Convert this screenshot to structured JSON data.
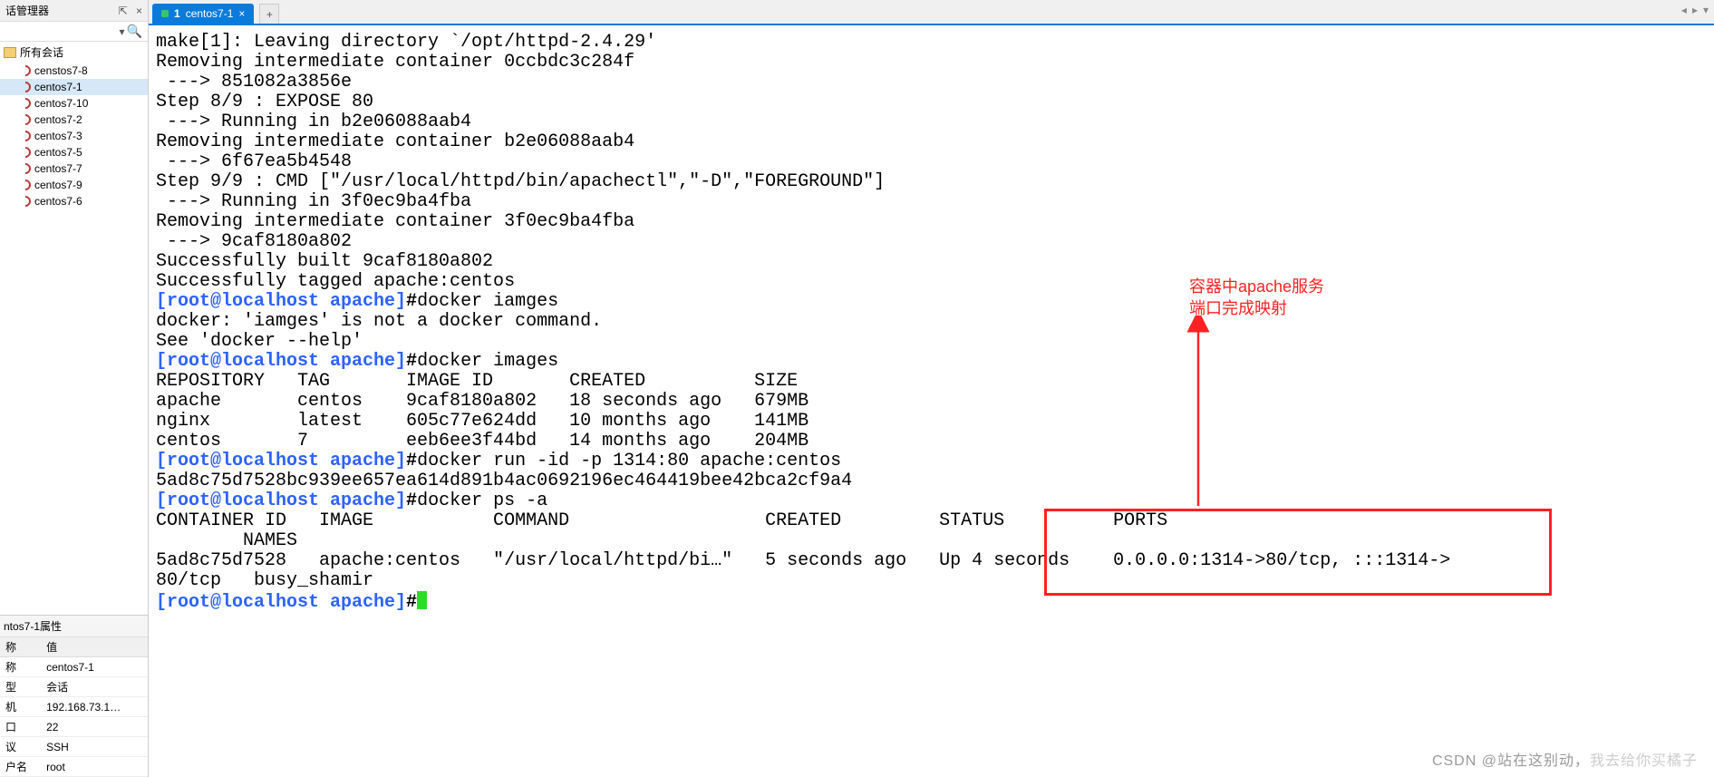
{
  "sidebar": {
    "title": "话管理器",
    "pin_char": "⇱",
    "close_char": "×",
    "dropdown_char": "▾",
    "search_glyph": "🔍",
    "root": "所有会话",
    "items": [
      {
        "label": "censtos7-8"
      },
      {
        "label": "centos7-1"
      },
      {
        "label": "centos7-10"
      },
      {
        "label": "centos7-2"
      },
      {
        "label": "centos7-3"
      },
      {
        "label": "centos7-5"
      },
      {
        "label": "centos7-7"
      },
      {
        "label": "centos7-9"
      },
      {
        "label": "centos7-6"
      }
    ],
    "selected_index": 1
  },
  "properties": {
    "title": "ntos7-1属性",
    "name_header": "称",
    "value_header": "值",
    "rows": [
      {
        "k": "称",
        "v": "centos7-1"
      },
      {
        "k": "型",
        "v": "会话"
      },
      {
        "k": "机",
        "v": "192.168.73.1…"
      },
      {
        "k": "口",
        "v": "22"
      },
      {
        "k": "议",
        "v": "SSH"
      },
      {
        "k": "户名",
        "v": "root"
      }
    ]
  },
  "tabs": {
    "active": {
      "index": "1",
      "label": "centos7-1",
      "close": "×"
    },
    "new_label": "+",
    "right_arrows": {
      "l": "◂",
      "r": "▸",
      "d": "▾"
    }
  },
  "terminal": {
    "lines_a": "make[1]: Leaving directory `/opt/httpd-2.4.29'\nRemoving intermediate container 0ccbdc3c284f\n ---> 851082a3856e\nStep 8/9 : EXPOSE 80\n ---> Running in b2e06088aab4\nRemoving intermediate container b2e06088aab4\n ---> 6f67ea5b4548\nStep 9/9 : CMD [\"/usr/local/httpd/bin/apachectl\",\"-D\",\"FOREGROUND\"]\n ---> Running in 3f0ec9ba4fba\nRemoving intermediate container 3f0ec9ba4fba\n ---> 9caf8180a802\nSuccessfully built 9caf8180a802\nSuccessfully tagged apache:centos",
    "cmd1": "docker iamges",
    "lines_b": "docker: 'iamges' is not a docker command.\nSee 'docker --help'",
    "cmd2": "docker images",
    "lines_c": "REPOSITORY   TAG       IMAGE ID       CREATED          SIZE\napache       centos    9caf8180a802   18 seconds ago   679MB\nnginx        latest    605c77e624dd   10 months ago    141MB\ncentos       7         eeb6ee3f44bd   14 months ago    204MB",
    "cmd3": "docker run -id -p 1314:80 apache:centos",
    "lines_d": "5ad8c75d7528bc939ee657ea614d891b4ac0692196ec464419bee42bca2cf9a4",
    "cmd4": "docker ps -a",
    "lines_e": "CONTAINER ID   IMAGE           COMMAND                  CREATED         STATUS          PORTS                                                                                                                                        \n        NAMES\n5ad8c75d7528   apache:centos   \"/usr/local/httpd/bi…\"   5 seconds ago   Up 4 seconds    0.0.0.0:1314->80/tcp, :::1314->           \n80/tcp   busy_shamir",
    "prompt": "[root@localhost apache]",
    "hash": "#"
  },
  "annotation": {
    "line1": "容器中apache服务",
    "line2": "端口完成映射"
  },
  "watermark": {
    "a": "CSDN @站在这别动，",
    "b": "我去给你买橘子"
  }
}
